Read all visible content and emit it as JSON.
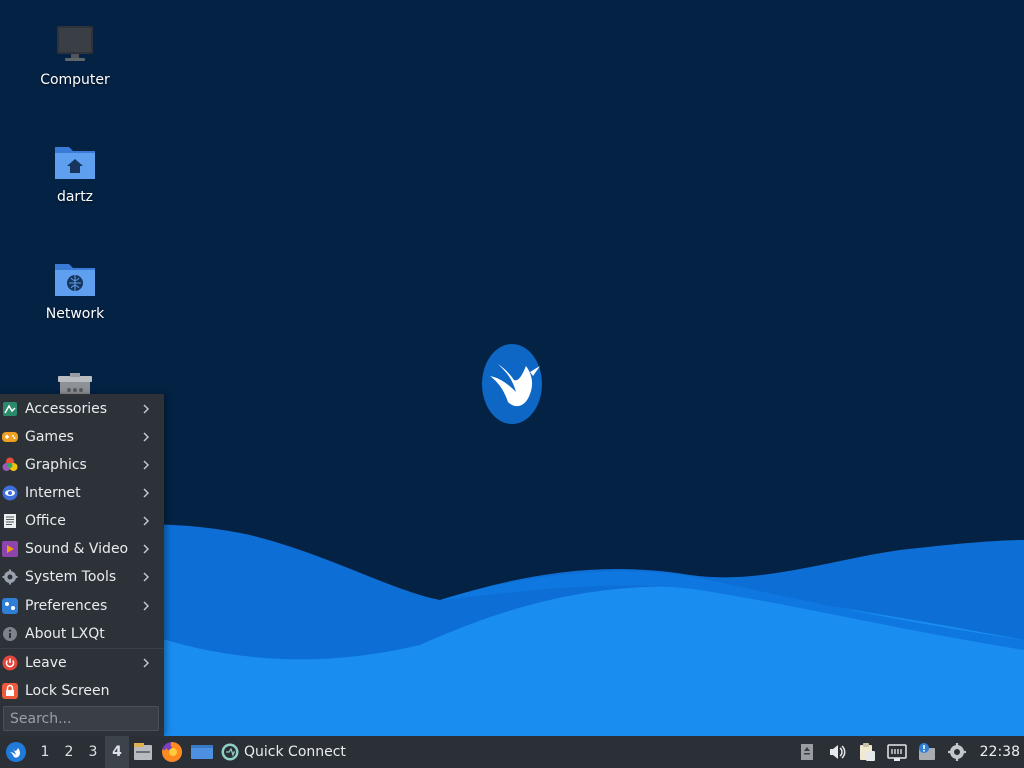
{
  "desktop": {
    "icons": [
      {
        "label": "Computer",
        "icon": "computer-icon"
      },
      {
        "label": "dartz",
        "icon": "home-folder-icon"
      },
      {
        "label": "Network",
        "icon": "network-folder-icon"
      },
      {
        "label": "",
        "icon": "trash-icon"
      }
    ],
    "wallpaper_logo": "lubuntu-hummingbird-logo"
  },
  "menu": {
    "items": [
      {
        "label": "Accessories",
        "icon": "accessories-icon",
        "submenu": true
      },
      {
        "label": "Games",
        "icon": "games-icon",
        "submenu": true
      },
      {
        "label": "Graphics",
        "icon": "graphics-icon",
        "submenu": true
      },
      {
        "label": "Internet",
        "icon": "internet-icon",
        "submenu": true
      },
      {
        "label": "Office",
        "icon": "office-icon",
        "submenu": true
      },
      {
        "label": "Sound & Video",
        "icon": "sound-video-icon",
        "submenu": true
      },
      {
        "label": "System Tools",
        "icon": "system-tools-icon",
        "submenu": true
      },
      {
        "label": "Preferences",
        "icon": "preferences-icon",
        "submenu": true
      },
      {
        "label": "About LXQt",
        "icon": "info-icon",
        "submenu": false
      },
      {
        "label": "Leave",
        "icon": "power-icon",
        "submenu": true
      },
      {
        "label": "Lock Screen",
        "icon": "lock-icon",
        "submenu": false
      }
    ],
    "search_placeholder": "Search..."
  },
  "taskbar": {
    "workspaces": [
      "1",
      "2",
      "3",
      "4"
    ],
    "active_workspace": "4",
    "quick_connect_label": "Quick Connect",
    "clock": "22:38"
  },
  "colors": {
    "background": "#042244",
    "wave_light": "#1a8df0",
    "wave_dark": "#0d6fd6",
    "menu_bg": "#2d3239",
    "taskbar_bg": "#2b3037"
  }
}
